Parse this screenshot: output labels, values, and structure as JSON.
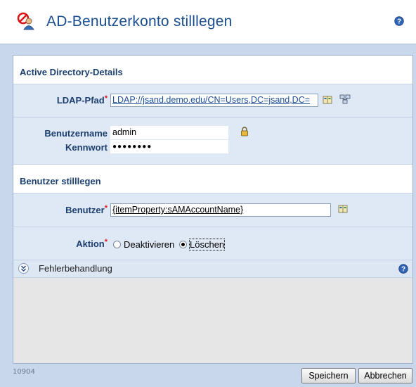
{
  "window": {
    "title": "AD-Benutzerkonto stilllegen",
    "footer_id": "10904"
  },
  "sections": {
    "ad_details": "Active Directory-Details",
    "deactivate_user": "Benutzer stilllegen"
  },
  "fields": {
    "ldap_label": "LDAP-Pfad",
    "ldap_value": "LDAP://jsand.demo.edu/CN=Users,DC=jsand,DC=",
    "username_label": "Benutzername",
    "username_value": "admin",
    "password_label": "Kennwort",
    "password_value": "●●●●●●●●",
    "user_label": "Benutzer",
    "user_value": "{itemProperty:sAMAccountName}",
    "action_label": "Aktion",
    "required_mark": "*"
  },
  "action_options": {
    "deactivate": "Deaktivieren",
    "delete": "Löschen",
    "selected": "delete"
  },
  "error_handling": {
    "label": "Fehlerbehandlung",
    "expanded": false
  },
  "buttons": {
    "save": "Speichern",
    "cancel": "Abbrechen"
  },
  "icons": {
    "app": "disable-user-icon",
    "help": "help-icon",
    "browse": "address-book-icon",
    "tree": "directory-tree-icon",
    "lock": "lock-icon",
    "collapse": "chevron-double-down-icon"
  },
  "colors": {
    "title": "#1a4e8f",
    "frame": "#c9d7ec",
    "row": "#dfe8f5",
    "required": "#d42020"
  }
}
